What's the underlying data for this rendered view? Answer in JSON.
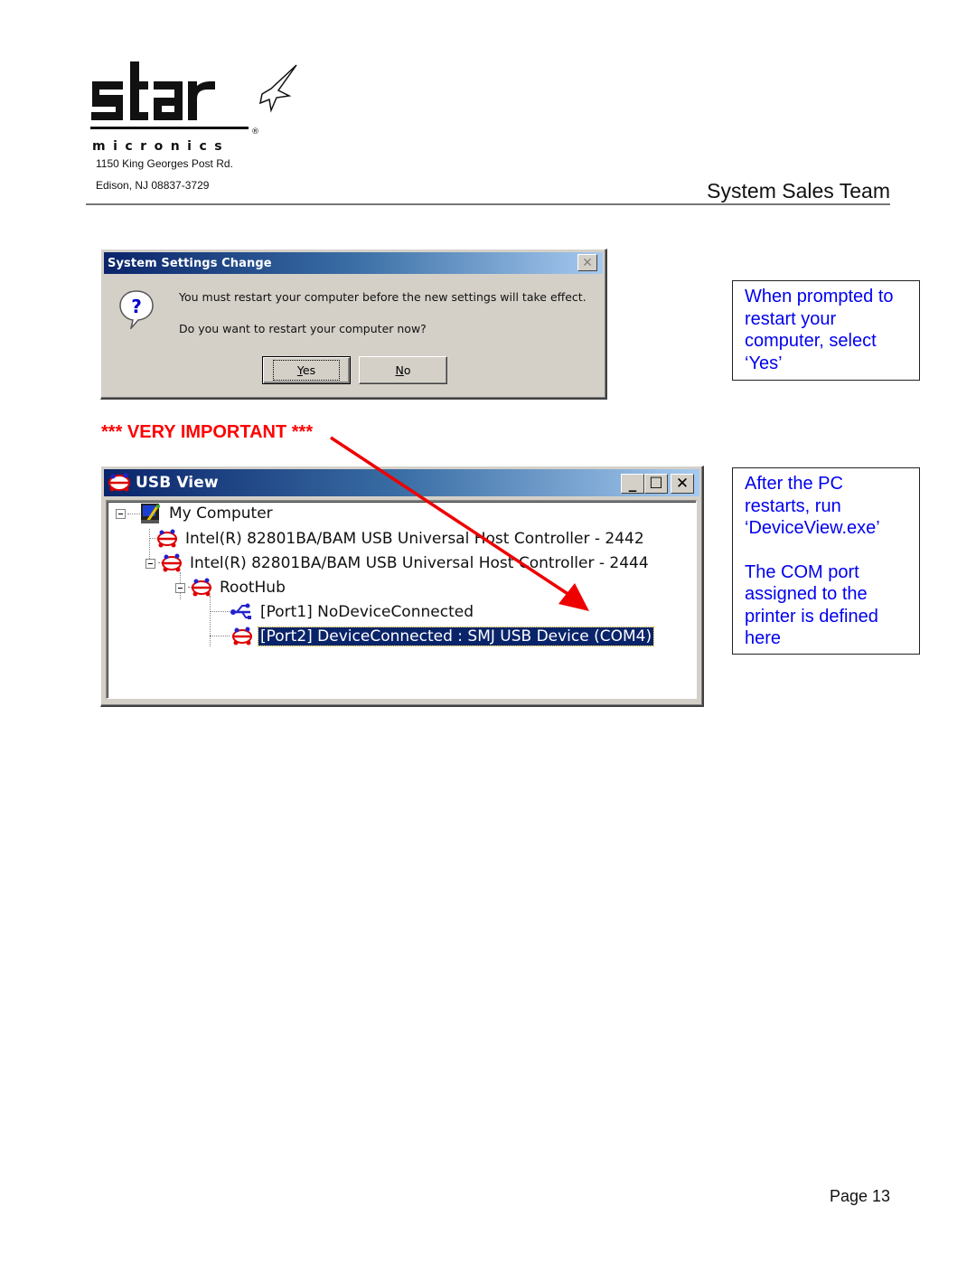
{
  "header": {
    "brand": "star micronics",
    "address_line1": "1150 King Georges Post Rd.",
    "address_line2": "Edison, NJ 08837-3729",
    "team_title": "System Sales Team"
  },
  "dialog": {
    "title": "System Settings Change",
    "icon": "question-icon",
    "message_line1": "You must restart your computer before the new settings will take effect.",
    "message_line2": "Do you want to restart your computer now?",
    "yes_mnemonic": "Y",
    "yes_rest": "es",
    "no_mnemonic": "N",
    "no_rest": "o",
    "close_glyph": "✕"
  },
  "important_label": "*** VERY IMPORTANT ***",
  "callouts": {
    "restart": "When prompted to restart your computer, select ‘Yes’",
    "deviceview_p1": "After the PC restarts, run ‘DeviceView.exe’",
    "deviceview_p2": "The COM port assigned to the printer is defined here"
  },
  "usb_view": {
    "title": "USB View",
    "minimize_glyph": "_",
    "maximize_glyph": "☐",
    "close_glyph": "✕",
    "tree": [
      {
        "label": "My Computer",
        "icon": "computer-icon",
        "level": 0,
        "expanded": true
      },
      {
        "label": "Intel(R) 82801BA/BAM USB Universal Host Controller - 2442",
        "icon": "usb-host-icon",
        "level": 1
      },
      {
        "label": "Intel(R) 82801BA/BAM USB Universal Host Controller - 2444",
        "icon": "usb-host-icon",
        "level": 1,
        "expanded": true
      },
      {
        "label": "RootHub",
        "icon": "usb-hub-icon",
        "level": 2,
        "expanded": true
      },
      {
        "label": "[Port1] NoDeviceConnected",
        "icon": "usb-port-icon",
        "level": 3
      },
      {
        "label": "[Port2] DeviceConnected : SMJ USB Device (COM4)",
        "icon": "usb-device-icon",
        "level": 3,
        "selected": true
      }
    ]
  },
  "footer": {
    "page": "Page 13"
  },
  "colors": {
    "callout_text": "#0000ee",
    "important": "#ff0000",
    "arrow": "#ee0000",
    "titlebar_start": "#0a246a",
    "titlebar_end": "#a6caf0"
  }
}
